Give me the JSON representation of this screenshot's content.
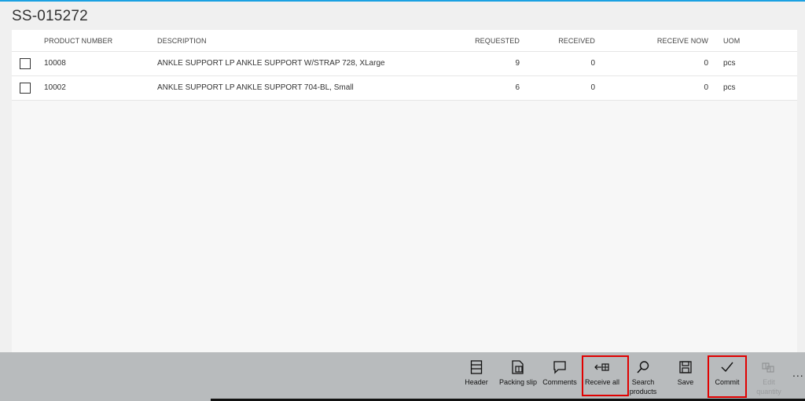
{
  "page": {
    "title": "SS-015272"
  },
  "grid": {
    "columns": {
      "product_number": "PRODUCT NUMBER",
      "description": "DESCRIPTION",
      "requested": "REQUESTED",
      "received": "RECEIVED",
      "receive_now": "RECEIVE NOW",
      "uom": "UOM"
    },
    "rows": [
      {
        "product_number": "10008",
        "description": "ANKLE SUPPORT LP ANKLE SUPPORT W/STRAP 728, XLarge",
        "requested": "9",
        "received": "0",
        "receive_now": "0",
        "uom": "pcs"
      },
      {
        "product_number": "10002",
        "description": "ANKLE SUPPORT LP ANKLE SUPPORT 704-BL, Small",
        "requested": "6",
        "received": "0",
        "receive_now": "0",
        "uom": "pcs"
      }
    ]
  },
  "actions": {
    "header": "Header",
    "packing_slip": "Packing slip",
    "comments": "Comments",
    "receive_all": "Receive all",
    "search_products_1": "Search",
    "search_products_2": "products",
    "save": "Save",
    "commit": "Commit",
    "edit_quantity_1": "Edit",
    "edit_quantity_2": "quantity",
    "more": "..."
  },
  "icons": {
    "header": "header-icon",
    "packing_slip": "packing-slip-icon",
    "comments": "comment-icon",
    "receive_all": "receive-all-icon",
    "search": "search-icon",
    "save": "save-icon",
    "commit": "checkmark-icon",
    "edit_quantity": "edit-quantity-icon"
  },
  "colors": {
    "accent": "#1ba1e2",
    "action_bar": "#b8bbbd",
    "highlight": "#e00000"
  }
}
